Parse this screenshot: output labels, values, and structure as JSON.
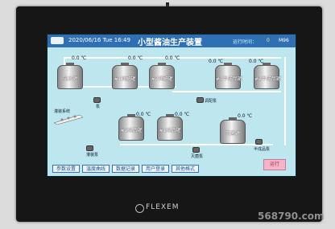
{
  "header": {
    "datetime": "2020/06/16 Tue 16:49",
    "title": "小型酱油生产装置",
    "runtime_label": "运行时间：",
    "runtime_value": "0",
    "version": "M96"
  },
  "tanks": [
    {
      "id": "water",
      "label": "盐水罐"
    },
    {
      "id": "mix1",
      "label": "#1调配罐"
    },
    {
      "id": "mix2",
      "label": "#2调配罐"
    },
    {
      "id": "semi1",
      "label": "#1半成品罐"
    },
    {
      "id": "semi2",
      "label": "#2半成品罐"
    },
    {
      "id": "prod2",
      "label": "#2成品罐"
    },
    {
      "id": "prod1",
      "label": "#1成品罐"
    },
    {
      "id": "sterile",
      "label": "灭菌罐"
    }
  ],
  "temperatures": [
    "0.0 ℃",
    "0.0 ℃",
    "0.0 ℃",
    "0.0 ℃",
    "0.0 ℃",
    "0.0 ℃",
    "0.0 ℃",
    "0.0 ℃"
  ],
  "equipment": {
    "pump_a": "泵",
    "pump_b": "调配泵",
    "pump_c": "灌装泵",
    "conveyor": "灌装系统",
    "pump_d": "灭菌泵",
    "pump_e": "半成品泵"
  },
  "nav": [
    "参数设置",
    "温度曲线",
    "数据记录",
    "用户登录",
    "其他格式"
  ],
  "run_button": "运行",
  "brand": "FLEXEM",
  "watermark": "568790.com",
  "colors": {
    "header": "#2f6fb4",
    "screen_bg": "#bde6ee",
    "run_button": "#f4b5c8"
  }
}
